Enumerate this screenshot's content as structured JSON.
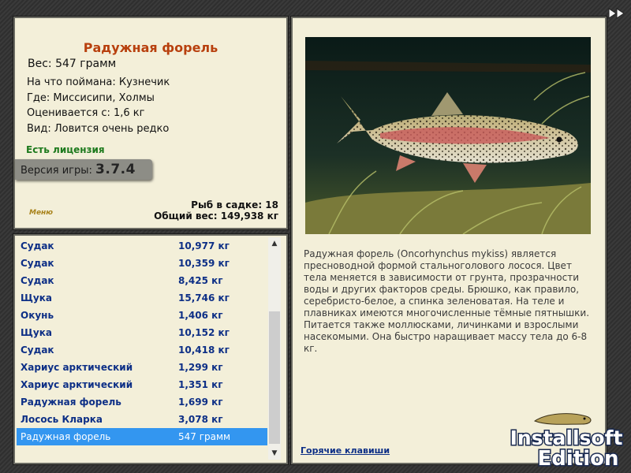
{
  "fish": {
    "name": "Радужная форель",
    "weight": "Вес: 547 грамм",
    "bait": "На что поймана: Кузнечик",
    "place": "Где: Миссисипи, Холмы",
    "value": "Оценивается с: 1,6 кг",
    "rarity": "Вид: Ловится очень редко"
  },
  "license": "Есть лицензия",
  "version": {
    "label": "Версия игры:",
    "number": "3.7.4"
  },
  "menu_label": "Меню",
  "cage": {
    "count": "Рыб в садке: 18",
    "total": "Общий вес: 149,938 кг"
  },
  "catch_list": [
    {
      "name": "Судак",
      "weight": "10,977 кг"
    },
    {
      "name": "Судак",
      "weight": "10,359 кг"
    },
    {
      "name": "Судак",
      "weight": "8,425 кг"
    },
    {
      "name": "Щука",
      "weight": "15,746 кг"
    },
    {
      "name": "Окунь",
      "weight": "1,406 кг"
    },
    {
      "name": "Щука",
      "weight": "10,152 кг"
    },
    {
      "name": "Судак",
      "weight": "10,418 кг"
    },
    {
      "name": "Хариус арктический",
      "weight": "1,299 кг"
    },
    {
      "name": "Хариус арктический",
      "weight": "1,351 кг"
    },
    {
      "name": "Радужная форель",
      "weight": "1,699 кг"
    },
    {
      "name": "Лосось Кларка",
      "weight": "3,078 кг"
    },
    {
      "name": "Радужная форель",
      "weight": "547 грамм"
    }
  ],
  "selected_index": 11,
  "description": "Радужная форель (Oncorhynchus mykiss) является пресноводной формой стальноголового лосося. Цвет тела меняется в зависимости от грунта, прозрачности воды и других факторов среды. Брюшко, как правило, серебристо-белое, а спинка зеленоватая. На теле и плавниках имеются многочисленные тёмные пятнышки. Питается также моллюсками, личинками и взрослыми насекомыми. Она быстро наращивает массу тела до 6-8 кг.",
  "hotkeys_link": "Горячие клавиши",
  "logo": {
    "line1": "Installsoft",
    "line2": "Edition"
  },
  "colors": {
    "panel": "#f3efd9",
    "title": "#b8400e",
    "list_text": "#0d2f86",
    "selected": "#3396f0",
    "license": "#1d7a1d"
  },
  "icons": {
    "forward": "fast-forward-icon",
    "scroll_up": "scroll-up-arrow-icon",
    "scroll_down": "scroll-down-arrow-icon"
  }
}
